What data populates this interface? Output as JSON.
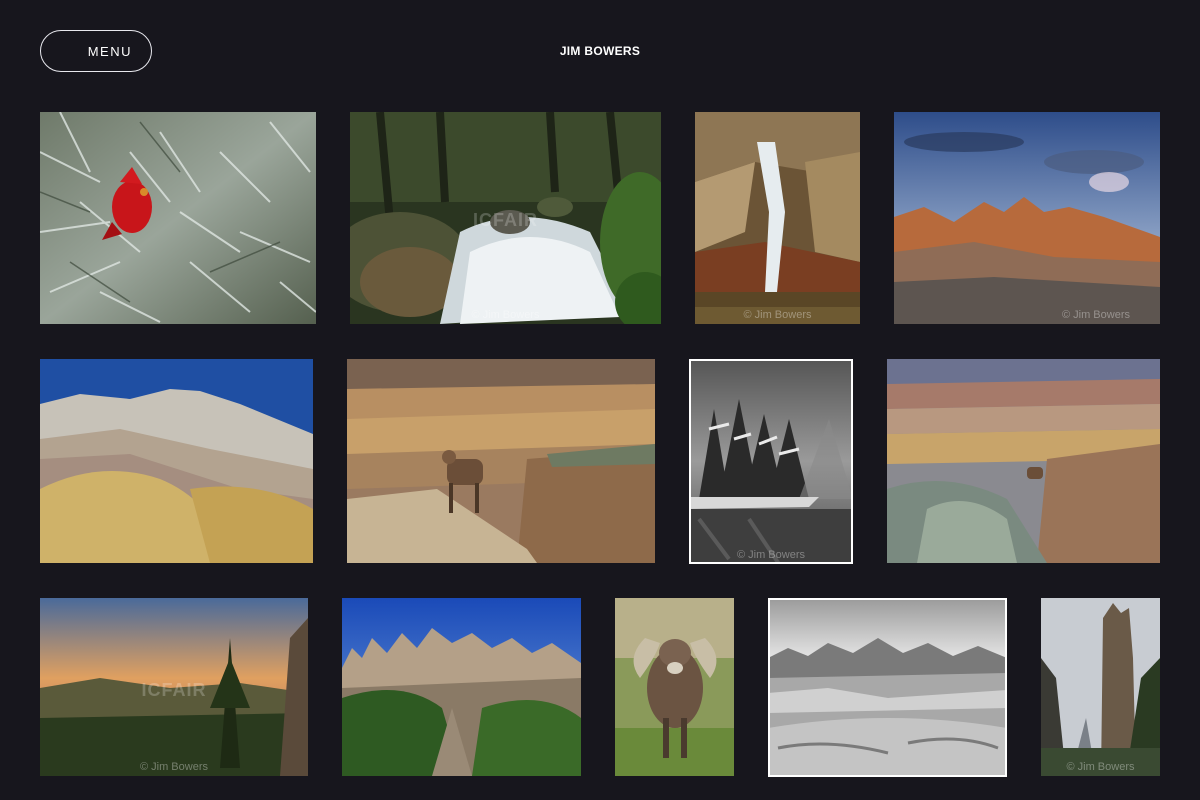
{
  "header": {
    "menu_label": "MENU",
    "title": "JIM BOWERS"
  },
  "gallery": {
    "watermark": "© Jim Bowers",
    "watermark_site": "ICFAIR",
    "items": [
      {
        "subject": "cardinal-in-spruce"
      },
      {
        "subject": "forest-waterfall"
      },
      {
        "subject": "cave-waterfall"
      },
      {
        "subject": "badlands-sunset-peaks"
      },
      {
        "subject": "yellow-mounds"
      },
      {
        "subject": "bighorn-on-ledge"
      },
      {
        "subject": "snowy-island-bw"
      },
      {
        "subject": "badlands-bighorn-distant"
      },
      {
        "subject": "pine-sunset"
      },
      {
        "subject": "needles-spires"
      },
      {
        "subject": "bighorn-ram"
      },
      {
        "subject": "badlands-bw"
      },
      {
        "subject": "misty-spire"
      }
    ]
  }
}
